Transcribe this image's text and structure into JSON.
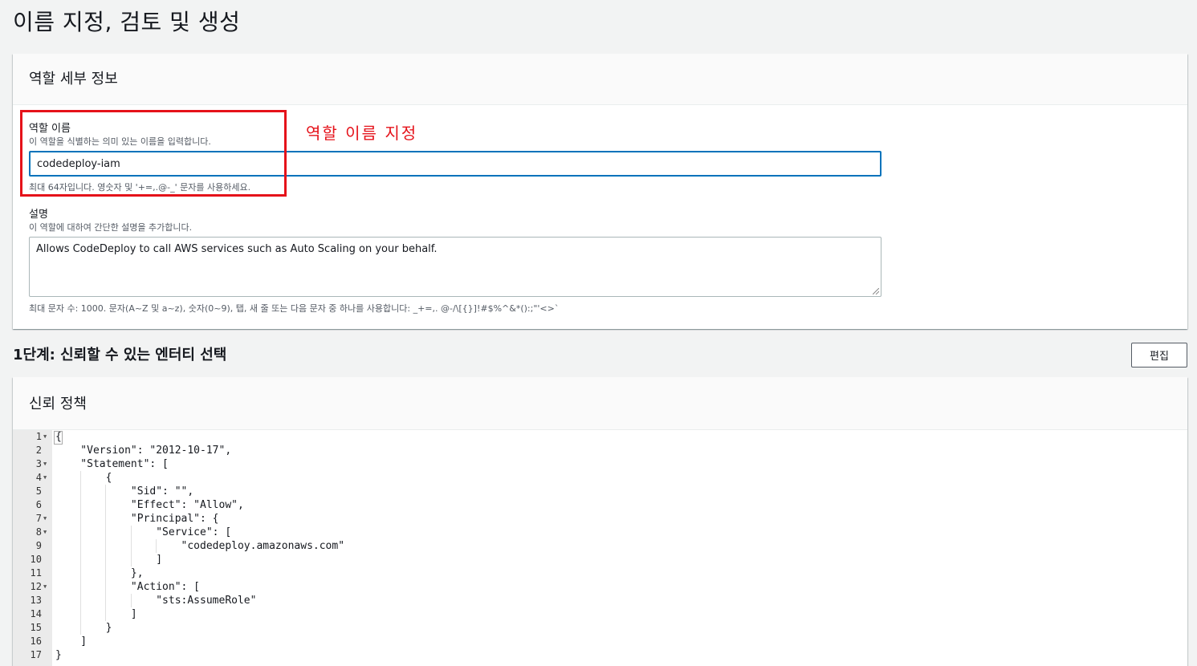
{
  "page_title": "이름 지정, 검토 및 생성",
  "details": {
    "header": "역할 세부 정보",
    "role_name": {
      "label": "역할 이름",
      "description": "이 역할을 식별하는 의미 있는 이름을 입력합니다.",
      "value": "codedeploy-iam",
      "constraint": "최대 64자입니다. 영숫자 및 '+=,.@-_' 문자를 사용하세요."
    },
    "description_field": {
      "label": "설명",
      "description": "이 역할에 대하여 간단한 설명을 추가합니다.",
      "value": "Allows CodeDeploy to call AWS services such as Auto Scaling on your behalf.",
      "constraint": "최대 문자 수: 1000. 문자(A~Z 및 a~z), 숫자(0~9), 탭, 새 줄 또는 다음 문자 중 하나를 사용합니다: _+=,. @-/\\[{}]!#$%^&*():;\"'<>`"
    },
    "annotation": "역할 이름 지정"
  },
  "step1": {
    "title": "1단계: 신뢰할 수 있는 엔터티 선택",
    "edit_label": "편집"
  },
  "trust_policy": {
    "header": "신뢰 정책",
    "lines": [
      {
        "num": "1",
        "fold": true,
        "text": "{"
      },
      {
        "num": "2",
        "fold": false,
        "text": "    \"Version\": \"2012-10-17\","
      },
      {
        "num": "3",
        "fold": true,
        "text": "    \"Statement\": ["
      },
      {
        "num": "4",
        "fold": true,
        "text": "        {"
      },
      {
        "num": "5",
        "fold": false,
        "text": "            \"Sid\": \"\","
      },
      {
        "num": "6",
        "fold": false,
        "text": "            \"Effect\": \"Allow\","
      },
      {
        "num": "7",
        "fold": true,
        "text": "            \"Principal\": {"
      },
      {
        "num": "8",
        "fold": true,
        "text": "                \"Service\": ["
      },
      {
        "num": "9",
        "fold": false,
        "text": "                    \"codedeploy.amazonaws.com\""
      },
      {
        "num": "10",
        "fold": false,
        "text": "                ]"
      },
      {
        "num": "11",
        "fold": false,
        "text": "            },"
      },
      {
        "num": "12",
        "fold": true,
        "text": "            \"Action\": ["
      },
      {
        "num": "13",
        "fold": false,
        "text": "                \"sts:AssumeRole\""
      },
      {
        "num": "14",
        "fold": false,
        "text": "            ]"
      },
      {
        "num": "15",
        "fold": false,
        "text": "        }"
      },
      {
        "num": "16",
        "fold": false,
        "text": "    ]"
      },
      {
        "num": "17",
        "fold": false,
        "text": "}"
      }
    ]
  },
  "colors": {
    "accent": "#0073bb",
    "annotation_red": "#e5121a",
    "background": "#f2f3f3"
  }
}
